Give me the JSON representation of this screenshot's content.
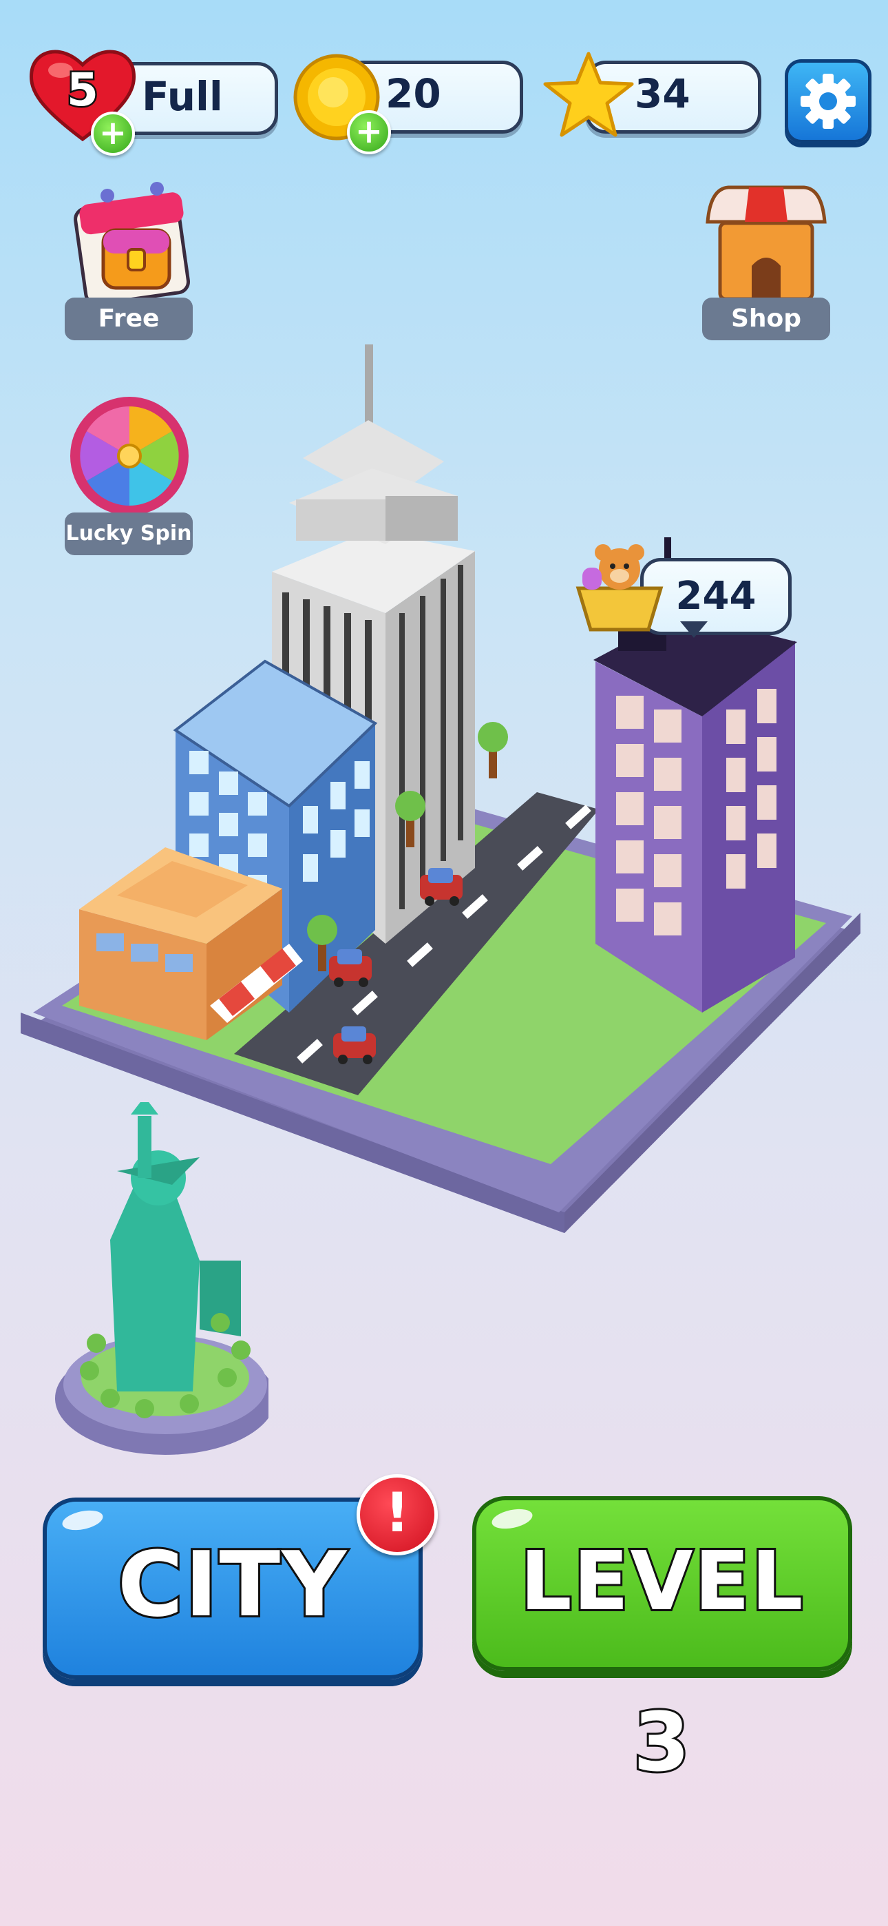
{
  "hud": {
    "lives": {
      "count": "5",
      "status": "Full",
      "icon": "heart-icon"
    },
    "coins": {
      "value": "20",
      "icon": "coin-icon"
    },
    "stars": {
      "value": "34",
      "icon": "star-icon"
    },
    "settings": {
      "icon": "gear-icon"
    }
  },
  "side_buttons": {
    "free_label": "Free",
    "shop_label": "Shop",
    "lucky_spin_label": "Lucky Spin"
  },
  "building_bubble": {
    "value": "244"
  },
  "actions": {
    "city_label": "CITY",
    "city_alert": "!",
    "level_label": "LEVEL 3"
  },
  "colors": {
    "city_button": "#2f94ea",
    "level_button": "#5ccc2a",
    "alert_badge": "#e11b2a",
    "island_base": "#7f78b3",
    "grass": "#8fd46a",
    "road": "#4a4c57"
  }
}
